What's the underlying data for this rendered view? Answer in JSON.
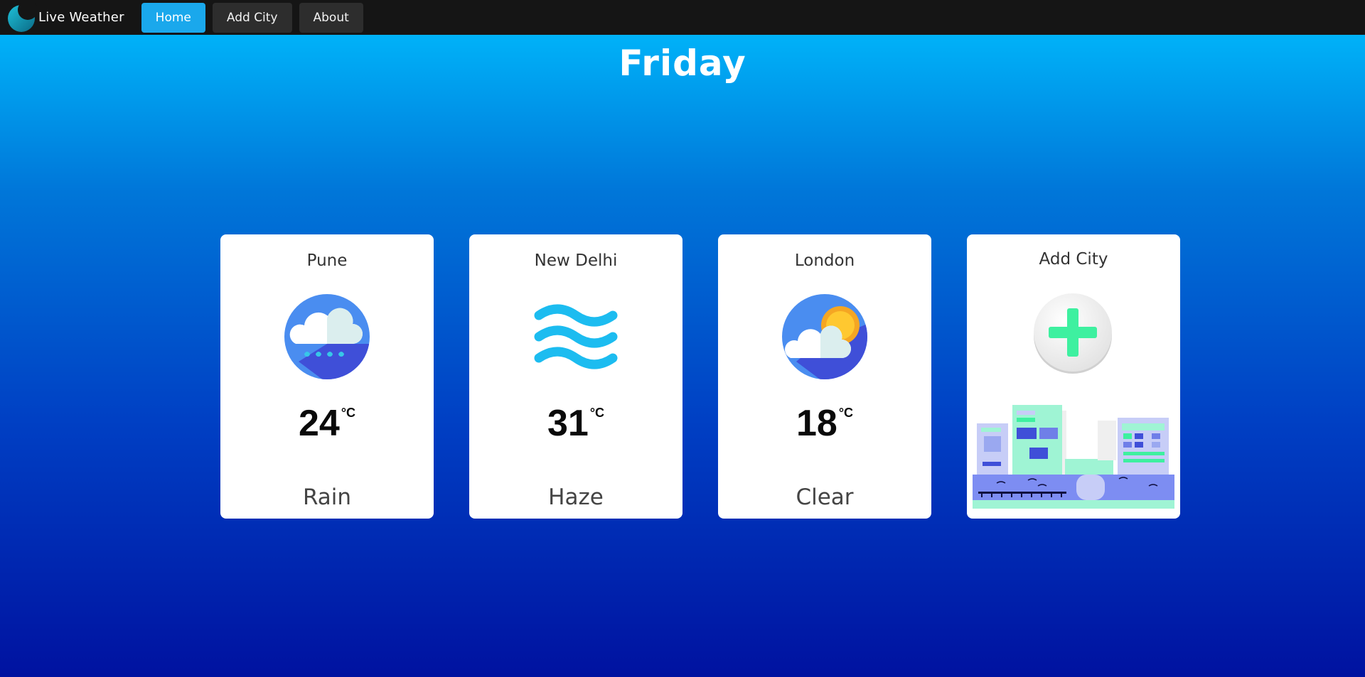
{
  "app": {
    "brand_name": "Live Weather"
  },
  "nav": {
    "items": [
      {
        "label": "Home",
        "active": true
      },
      {
        "label": "Add City",
        "active": false
      },
      {
        "label": "About",
        "active": false
      }
    ]
  },
  "main": {
    "day": "Friday",
    "cities": [
      {
        "name": "Pune",
        "temperature": "24",
        "unit": "°C",
        "condition": "Rain",
        "icon": "rain-cloud-icon"
      },
      {
        "name": "New Delhi",
        "temperature": "31",
        "unit": "°C",
        "condition": "Haze",
        "icon": "haze-icon"
      },
      {
        "name": "London",
        "temperature": "18",
        "unit": "°C",
        "condition": "Clear",
        "icon": "sun-cloud-icon"
      }
    ],
    "add_city_card": {
      "title": "Add City",
      "icon": "plus-icon"
    }
  },
  "colors": {
    "navbar_bg": "#151515",
    "active_nav": "#1aa8ec",
    "nav_button": "#2d2d2d",
    "gradient_top": "#00bfff",
    "gradient_bottom": "#0012a0",
    "plus_green": "#3ef0a0"
  }
}
